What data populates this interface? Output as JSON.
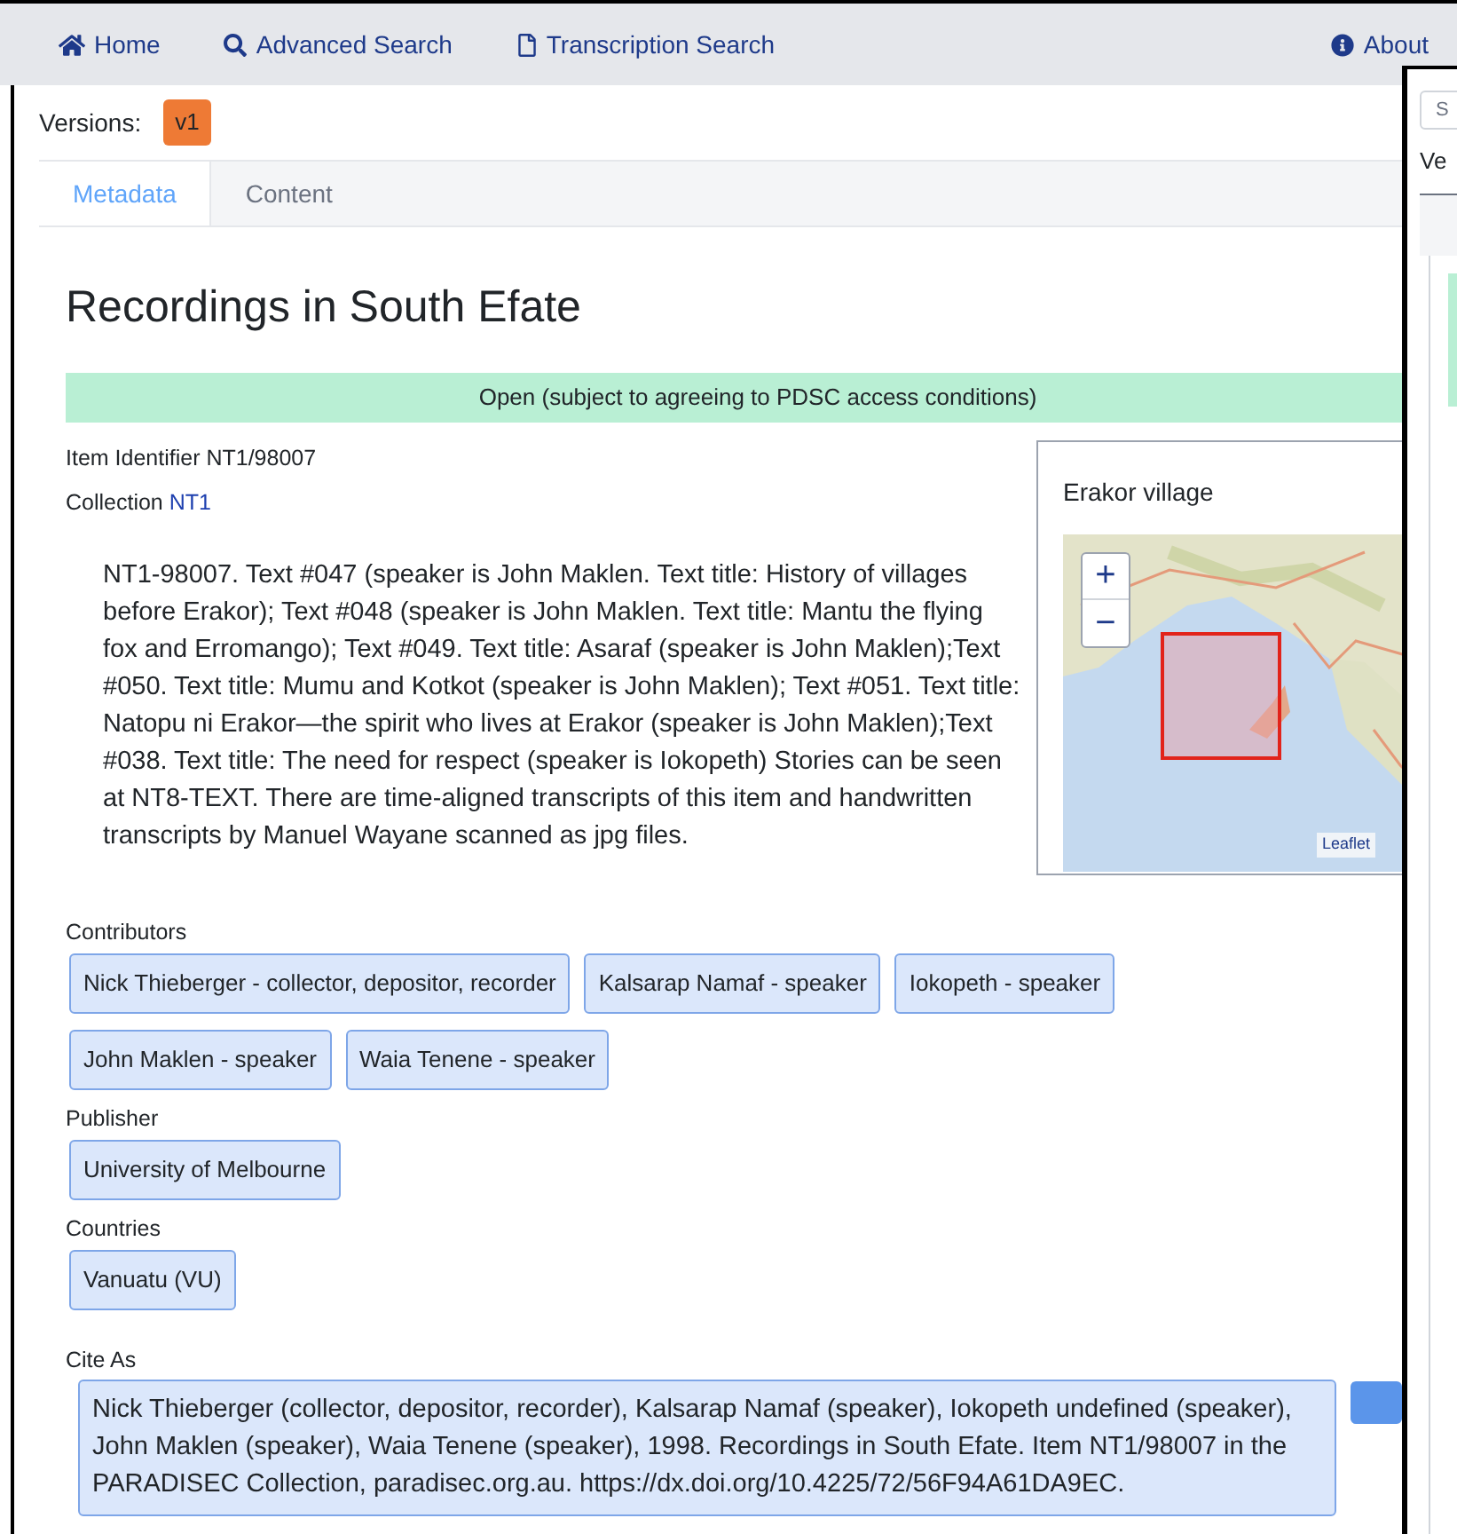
{
  "nav": {
    "items": [
      {
        "label": "Home",
        "kind": "home"
      },
      {
        "label": "Advanced Search",
        "kind": "search"
      },
      {
        "label": "Transcription Search",
        "kind": "file"
      }
    ],
    "right_item": {
      "label": "About",
      "kind": "info"
    }
  },
  "versions": {
    "label": "Versions:",
    "badges": [
      "v1"
    ]
  },
  "tabs": [
    {
      "label": "Metadata",
      "selected": true
    },
    {
      "label": "Content",
      "selected": false
    }
  ],
  "title": "Recordings in South Efate",
  "access_alert": "Open (subject to agreeing to PDSC access conditions)",
  "fields": [
    {
      "label": "Item Identifier",
      "value": "NT1/98007",
      "kind": "text"
    },
    {
      "label": "Collection",
      "value": "NT1",
      "kind": "link"
    }
  ],
  "description": "NT1-98007. Text #047 (speaker is John Maklen. Text title: History of villages before Erakor); Text #048 (speaker is John Maklen. Text title: Mantu the flying fox and Erromango); Text #049. Text title: Asaraf (speaker is John Maklen);Text #050. Text title: Mumu and Kotkot (speaker is John Maklen); Text #051. Text title: Natopu ni Erakor—the spirit who lives at Erakor (speaker is John Maklen);Text #038. Text title: The need for respect (speaker is Iokopeth) Stories can be seen at NT8-TEXT. There are time-aligned transcripts of this item and handwritten transcripts by Manuel Wayane scanned as jpg files.",
  "map": {
    "title": "Erakor village",
    "zoom_in": "+",
    "zoom_out": "−",
    "attribution": "Leaflet"
  },
  "groups": [
    {
      "label": "Contributors",
      "badges": [
        "Nick Thieberger - collector, depositor, recorder",
        "Kalsarap Namaf - speaker",
        "Iokopeth - speaker",
        "John Maklen - speaker",
        "Waia Tenene - speaker"
      ]
    },
    {
      "label": "Publisher",
      "badges": [
        "University of Melbourne"
      ]
    },
    {
      "label": "Countries",
      "badges": [
        "Vanuatu (VU)"
      ]
    }
  ],
  "cite": {
    "label": "Cite As",
    "text": "Nick Thieberger (collector, depositor, recorder), Kalsarap Namaf (speaker), Iokopeth undefined (speaker), John Maklen (speaker), Waia Tenene (speaker), 1998. Recordings in South Efate. Item NT1/98007 in the PARADISEC Collection, paradisec.org.au. https://dx.doi.org/10.4225/72/56F94A61DA9EC."
  },
  "second_window": {
    "search_placeholder": "S",
    "label": "Ve"
  }
}
